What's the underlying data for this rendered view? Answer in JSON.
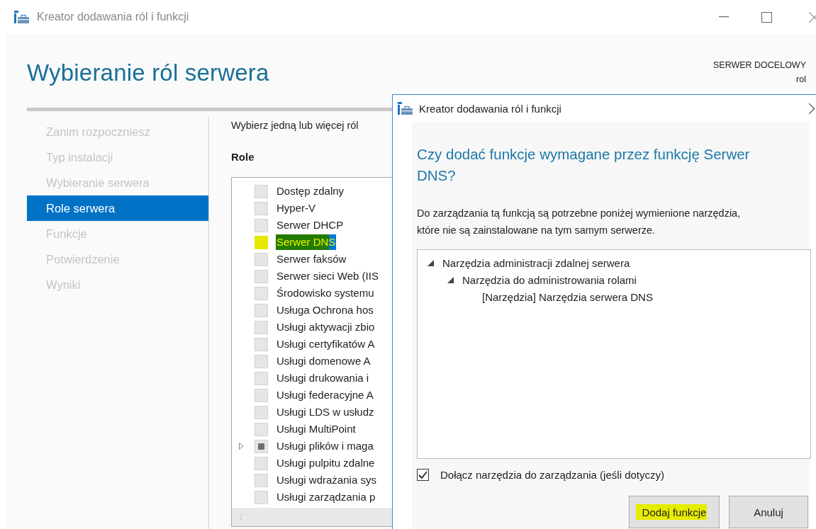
{
  "window": {
    "title": "Kreator dodawania ról i funkcji"
  },
  "page_title": "Wybieranie ról serwera",
  "target_server": {
    "label": "SERWER DOCELOWY",
    "value": "rol"
  },
  "nav": [
    {
      "label": "Zanim rozpoczniesz",
      "selected": false
    },
    {
      "label": "Typ instalacji",
      "selected": false
    },
    {
      "label": "Wybieranie serwera",
      "selected": false
    },
    {
      "label": "Role serwera",
      "selected": true
    },
    {
      "label": "Funkcje",
      "selected": false
    },
    {
      "label": "Potwierdzenie",
      "selected": false
    },
    {
      "label": "Wyniki",
      "selected": false
    }
  ],
  "instruction": "Wybierz jedną lub więcej ról",
  "roles_heading": "Role",
  "roles": [
    {
      "label": "Dostęp zdalny",
      "indeterminate": false,
      "selected": false,
      "marked": false,
      "expandable": false
    },
    {
      "label": "Hyper-V",
      "indeterminate": false,
      "selected": false,
      "marked": false,
      "expandable": false
    },
    {
      "label": "Serwer DHCP",
      "indeterminate": false,
      "selected": false,
      "marked": false,
      "expandable": false
    },
    {
      "label": "Serwer DNS",
      "indeterminate": false,
      "selected": true,
      "marked": true,
      "expandable": false
    },
    {
      "label": "Serwer faksów",
      "indeterminate": false,
      "selected": false,
      "marked": false,
      "expandable": false
    },
    {
      "label": "Serwer sieci Web (IIS",
      "indeterminate": false,
      "selected": false,
      "marked": false,
      "expandable": false
    },
    {
      "label": "Środowisko systemu",
      "indeterminate": false,
      "selected": false,
      "marked": false,
      "expandable": false
    },
    {
      "label": "Usługa Ochrona hos",
      "indeterminate": false,
      "selected": false,
      "marked": false,
      "expandable": false
    },
    {
      "label": "Usługi aktywacji zbio",
      "indeterminate": false,
      "selected": false,
      "marked": false,
      "expandable": false
    },
    {
      "label": "Usługi certyfikatów A",
      "indeterminate": false,
      "selected": false,
      "marked": false,
      "expandable": false
    },
    {
      "label": "Usługi domenowe A",
      "indeterminate": false,
      "selected": false,
      "marked": false,
      "expandable": false
    },
    {
      "label": "Usługi drukowania i",
      "indeterminate": false,
      "selected": false,
      "marked": false,
      "expandable": false
    },
    {
      "label": "Usługi federacyjne A",
      "indeterminate": false,
      "selected": false,
      "marked": false,
      "expandable": false
    },
    {
      "label": "Usługi LDS w usłudz",
      "indeterminate": false,
      "selected": false,
      "marked": false,
      "expandable": false
    },
    {
      "label": "Usługi MultiPoint",
      "indeterminate": false,
      "selected": false,
      "marked": false,
      "expandable": false
    },
    {
      "label": "Usługi plików i maga",
      "indeterminate": true,
      "selected": false,
      "marked": false,
      "expandable": true
    },
    {
      "label": "Usługi pulpitu zdalne",
      "indeterminate": false,
      "selected": false,
      "marked": false,
      "expandable": false
    },
    {
      "label": "Usługi wdrażania sys",
      "indeterminate": false,
      "selected": false,
      "marked": false,
      "expandable": false
    },
    {
      "label": "Usługi zarządzania p",
      "indeterminate": false,
      "selected": false,
      "marked": false,
      "expandable": false
    }
  ],
  "dialog": {
    "title": "Kreator dodawania ról i funkcji",
    "heading": "Czy dodać funkcje wymagane przez funkcję Serwer DNS?",
    "message": "Do zarządzania tą funkcją są potrzebne poniżej wymienione narzędzia, które nie są zainstalowane na tym samym serwerze.",
    "tree": [
      {
        "label": "Narzędzia administracji zdalnej serwera",
        "expanded": true,
        "children": [
          {
            "label": "Narzędzia do administrowania rolami",
            "expanded": true,
            "children": [
              {
                "label": "[Narzędzia] Narzędzia serwera DNS"
              }
            ]
          }
        ]
      }
    ],
    "include_tools": {
      "label": "Dołącz narzędzia do zarządzania (jeśli dotyczy)",
      "checked": true
    },
    "buttons": [
      {
        "label": "Dodaj funkcje",
        "marked": true
      },
      {
        "label": "Anuluj",
        "marked": false
      }
    ]
  }
}
